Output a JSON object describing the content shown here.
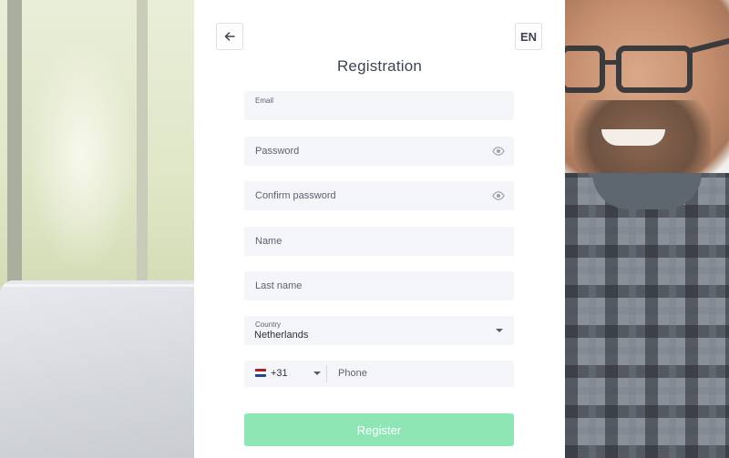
{
  "header": {
    "title": "Registration",
    "language": "EN"
  },
  "form": {
    "email": {
      "label": "Email",
      "value": ""
    },
    "password": {
      "placeholder": "Password"
    },
    "confirm_password": {
      "placeholder": "Confirm password"
    },
    "name": {
      "placeholder": "Name"
    },
    "last_name": {
      "placeholder": "Last name"
    },
    "country": {
      "label": "Country",
      "value": "Netherlands"
    },
    "phone": {
      "country_code": "+31",
      "placeholder": "Phone"
    },
    "submit_label": "Register"
  },
  "icons": {
    "back": "arrow-left-icon",
    "password_visibility": "eye-icon",
    "dropdown": "chevron-down-icon",
    "flag": "netherlands-flag-icon"
  },
  "colors": {
    "register_button": "#8ee6b5",
    "field_background": "#f4f5f8",
    "title_text": "#3d4451",
    "flag_red": "#ae1c28",
    "flag_white": "#ffffff",
    "flag_blue": "#21468b"
  }
}
